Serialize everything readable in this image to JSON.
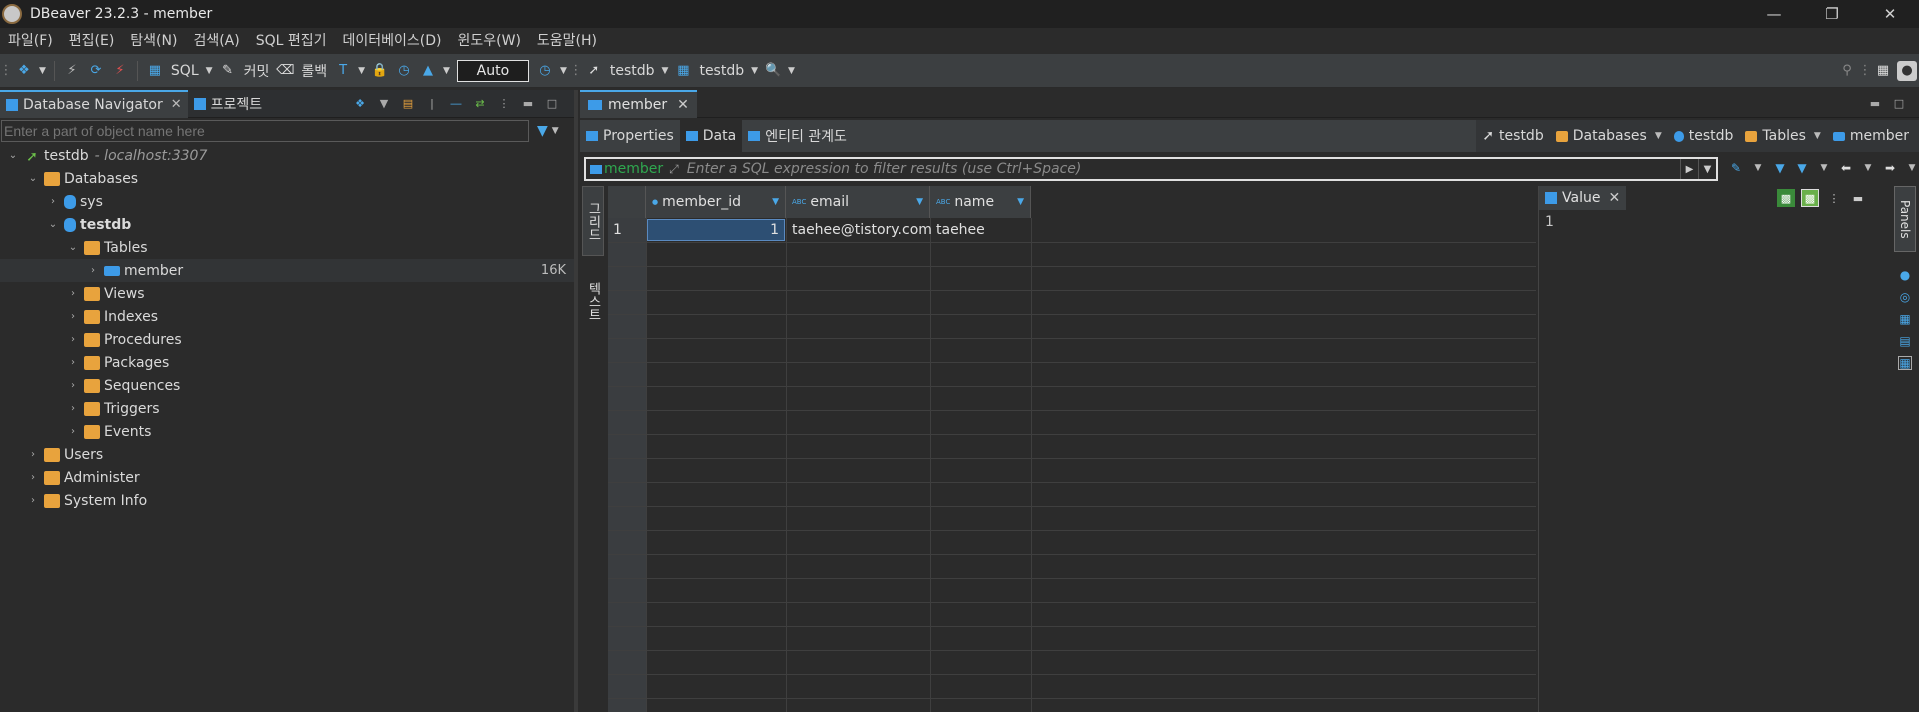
{
  "window": {
    "title": "DBeaver 23.2.3 - member",
    "controls": [
      "minimize",
      "restore",
      "close"
    ]
  },
  "menu": [
    "파일(F)",
    "편집(E)",
    "탐색(N)",
    "검색(A)",
    "SQL 편집기",
    "데이터베이스(D)",
    "윈도우(W)",
    "도움말(H)"
  ],
  "toolbar": {
    "sql_label": "SQL",
    "commit_label": "커밋",
    "rollback_label": "롤백",
    "transaction_mode": "Auto",
    "active_datasource": "testdb",
    "active_schema": "testdb"
  },
  "navigator": {
    "tab_label": "Database Navigator",
    "project_tab_label": "프로젝트",
    "filter_placeholder": "Enter a part of object name here",
    "connection_name": "testdb",
    "connection_host": "- localhost:3307",
    "items": {
      "databases": "Databases",
      "sys": "sys",
      "testdb": "testdb",
      "tables": "Tables",
      "member": "member",
      "member_size": "16K",
      "views": "Views",
      "indexes": "Indexes",
      "procedures": "Procedures",
      "packages": "Packages",
      "sequences": "Sequences",
      "triggers": "Triggers",
      "events": "Events",
      "users": "Users",
      "administer": "Administer",
      "system_info": "System Info"
    }
  },
  "editor": {
    "tab_label": "member",
    "subtabs": [
      "Properties",
      "Data",
      "엔티티 관계도"
    ],
    "active_subtab": "Data",
    "breadcrumbs": [
      "testdb",
      "Databases",
      "testdb",
      "Tables",
      "member"
    ],
    "filter_table": "member",
    "filter_placeholder": "Enter a SQL expression to filter results (use Ctrl+Space)",
    "side_tabs": [
      "그리드",
      "텍스트"
    ],
    "grid": {
      "columns": [
        "member_id",
        "email",
        "name"
      ],
      "rows": [
        {
          "row_number": "1",
          "member_id": "1",
          "email": "taehee@tistory.com",
          "name": "taehee"
        }
      ]
    },
    "value_panel": {
      "tab_label": "Value",
      "value": "1"
    },
    "panels_label": "Panels"
  }
}
